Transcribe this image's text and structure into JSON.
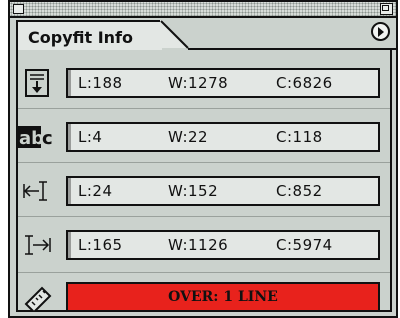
{
  "panel": {
    "tab_label": "Copyfit Info"
  },
  "rows": [
    {
      "icon": "story-icon",
      "l": "L:188",
      "w": "W:1278",
      "c": "C:6826"
    },
    {
      "icon": "selection-icon",
      "l": "L:4",
      "w": "W:22",
      "c": "C:118"
    },
    {
      "icon": "before-cursor-icon",
      "l": "L:24",
      "w": "W:152",
      "c": "C:852"
    },
    {
      "icon": "after-cursor-icon",
      "l": "L:165",
      "w": "W:1126",
      "c": "C:5974"
    }
  ],
  "status": {
    "text": "OVER: 1 LINE",
    "color": "#e8221c"
  },
  "colors": {
    "panel_bg": "#cbd2cd",
    "field_bg": "#e3e7e4"
  }
}
